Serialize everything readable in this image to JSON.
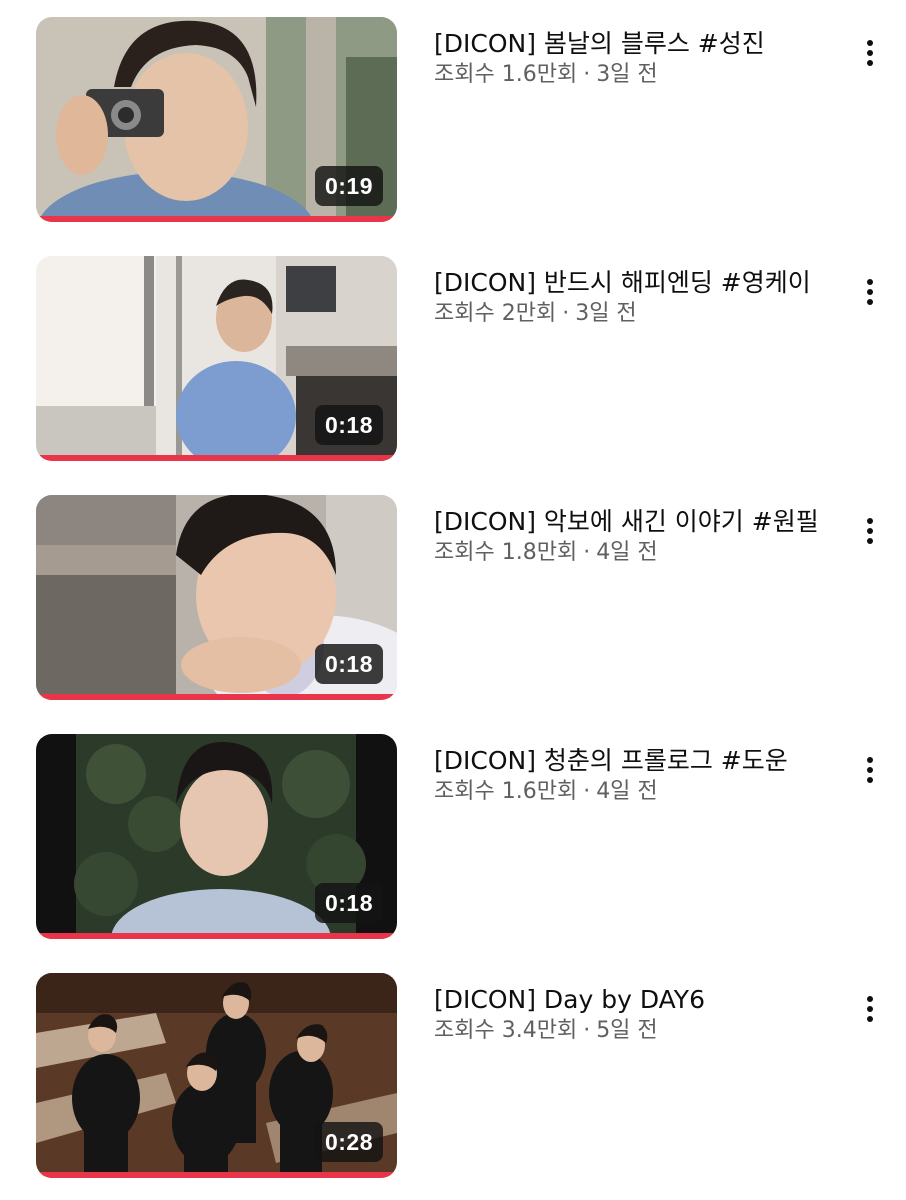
{
  "videos": [
    {
      "title": "[DICON] 봄날의 블루스 #성진",
      "views": "조회수 1.6만회",
      "age": "3일 전",
      "duration": "0:19",
      "watched_fraction": 1.0,
      "thumbnail": "person-with-camera"
    },
    {
      "title": "[DICON] 반드시 해피엔딩 #영케이",
      "views": "조회수 2만회",
      "age": "3일 전",
      "duration": "0:18",
      "watched_fraction": 1.0,
      "thumbnail": "person-in-alley"
    },
    {
      "title": "[DICON] 악보에 새긴 이야기 #원필",
      "views": "조회수 1.8만회",
      "age": "4일 전",
      "duration": "0:18",
      "watched_fraction": 1.0,
      "thumbnail": "person-closeup"
    },
    {
      "title": "[DICON] 청춘의 프롤로그 #도운",
      "views": "조회수 1.6만회",
      "age": "4일 전",
      "duration": "0:18",
      "watched_fraction": 1.0,
      "thumbnail": "person-with-foliage"
    },
    {
      "title": "[DICON] Day by DAY6",
      "views": "조회수 3.4만회",
      "age": "5일 전",
      "duration": "0:28",
      "watched_fraction": 1.0,
      "thumbnail": "group-of-four"
    }
  ],
  "colors": {
    "progress": "#e8354a",
    "title_text": "#0f0f0f",
    "secondary_text": "#606060",
    "duration_badge": "#141414"
  },
  "icons": {
    "more": "more-vert-icon",
    "separator": "·"
  }
}
